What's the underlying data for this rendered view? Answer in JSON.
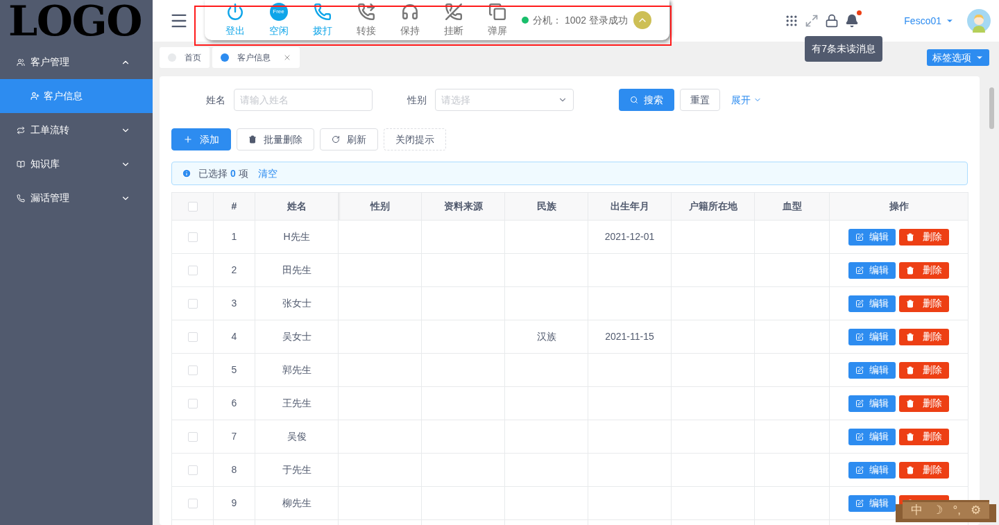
{
  "logo": "LOGO",
  "sidebar": {
    "items": [
      {
        "label": "客户管理",
        "expanded": true,
        "children": [
          {
            "label": "客户信息",
            "selected": true
          }
        ]
      },
      {
        "label": "工单流转",
        "expanded": false
      },
      {
        "label": "知识库",
        "expanded": false
      },
      {
        "label": "漏话管理",
        "expanded": false
      }
    ]
  },
  "call_toolbar": {
    "items": [
      {
        "label": "登出",
        "kind": "power",
        "disabled": false
      },
      {
        "label": "空闲",
        "kind": "free",
        "icon_text": "Free",
        "disabled": false
      },
      {
        "label": "拨打",
        "kind": "dial",
        "disabled": false
      },
      {
        "label": "转接",
        "kind": "transfer",
        "disabled": true
      },
      {
        "label": "保持",
        "kind": "hold",
        "disabled": true
      },
      {
        "label": "挂断",
        "kind": "hangup",
        "disabled": true
      },
      {
        "label": "弹屏",
        "kind": "popup",
        "disabled": true
      }
    ],
    "status": {
      "online": true,
      "text": "分机： 1002 登录成功"
    }
  },
  "header": {
    "user": "Fesco01",
    "unread_dot": true,
    "tooltip": "有7条未读消息"
  },
  "tabs": [
    {
      "label": "首页",
      "selected": false,
      "closable": false
    },
    {
      "label": "客户信息",
      "selected": true,
      "closable": true
    }
  ],
  "tab_options": "标签选项",
  "filters": [
    {
      "label": "姓名",
      "kind": "input",
      "placeholder": "请输入姓名"
    },
    {
      "label": "性别",
      "kind": "select",
      "placeholder": "请选择"
    }
  ],
  "filter_buttons": {
    "search": "搜索",
    "reset": "重置",
    "expand": "展开"
  },
  "actions": [
    {
      "label": "添加",
      "kind": "add"
    },
    {
      "label": "批量删除",
      "kind": "delete"
    },
    {
      "label": "刷新",
      "kind": "refresh"
    },
    {
      "label": "关闭提示",
      "kind": "dashed"
    }
  ],
  "selection_alert": {
    "prefix": "已选择",
    "count": "0",
    "suffix": "项",
    "clear": "清空"
  },
  "table": {
    "select_all_checked": false,
    "columns": [
      "#",
      "姓名",
      "性别",
      "资料来源",
      "民族",
      "出生年月",
      "户籍所在地",
      "血型",
      "操作"
    ],
    "rows": [
      {
        "cells": [
          "1",
          "H先生",
          "",
          "",
          "",
          "2021-12-01",
          "",
          ""
        ],
        "checked": false,
        "edit": "编辑",
        "delete": "删除"
      },
      {
        "cells": [
          "2",
          "田先生",
          "",
          "",
          "",
          "",
          "",
          ""
        ],
        "checked": false,
        "edit": "编辑",
        "delete": "删除"
      },
      {
        "cells": [
          "3",
          "张女士",
          "",
          "",
          "",
          "",
          "",
          ""
        ],
        "checked": false,
        "edit": "编辑",
        "delete": "删除"
      },
      {
        "cells": [
          "4",
          "吴女士",
          "",
          "",
          "汉族",
          "2021-11-15",
          "",
          ""
        ],
        "checked": false,
        "edit": "编辑",
        "delete": "删除"
      },
      {
        "cells": [
          "5",
          "郭先生",
          "",
          "",
          "",
          "",
          "",
          ""
        ],
        "checked": false,
        "edit": "编辑",
        "delete": "删除"
      },
      {
        "cells": [
          "6",
          "王先生",
          "",
          "",
          "",
          "",
          "",
          ""
        ],
        "checked": false,
        "edit": "编辑",
        "delete": "删除"
      },
      {
        "cells": [
          "7",
          "吴俊",
          "",
          "",
          "",
          "",
          "",
          ""
        ],
        "checked": false,
        "edit": "编辑",
        "delete": "删除"
      },
      {
        "cells": [
          "8",
          "于先生",
          "",
          "",
          "",
          "",
          "",
          ""
        ],
        "checked": false,
        "edit": "编辑",
        "delete": "删除"
      },
      {
        "cells": [
          "9",
          "柳先生",
          "",
          "",
          "",
          "",
          "",
          ""
        ],
        "checked": false,
        "edit": "编辑"
      }
    ]
  },
  "ime_bar": [
    "中",
    "☽",
    "°,",
    "⚙"
  ]
}
